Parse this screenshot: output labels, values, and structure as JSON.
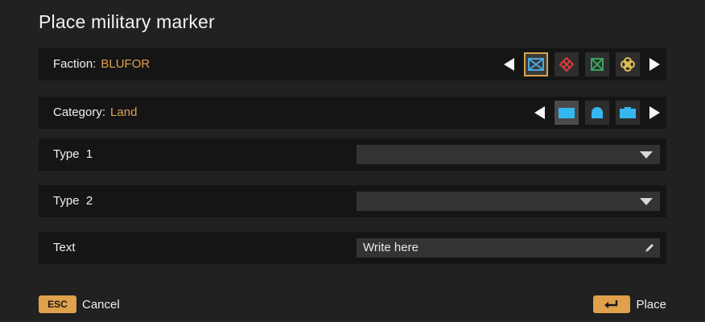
{
  "dialog": {
    "title": "Place military marker"
  },
  "faction": {
    "label": "Faction:",
    "value": "BLUFOR",
    "options": [
      {
        "name": "blufor-icon",
        "color": "#4aa8e0",
        "selected": true
      },
      {
        "name": "opfor-icon",
        "color": "#e03a3a",
        "selected": false
      },
      {
        "name": "independent-icon",
        "color": "#3aa35a",
        "selected": false
      },
      {
        "name": "civilian-icon",
        "color": "#e0c050",
        "selected": false
      }
    ]
  },
  "category": {
    "label": "Category:",
    "value": "Land",
    "options": [
      {
        "name": "land-icon",
        "color": "#35b8ef",
        "selected": true
      },
      {
        "name": "air-icon",
        "color": "#35b8ef",
        "selected": false
      },
      {
        "name": "sea-icon",
        "color": "#35b8ef",
        "selected": false
      }
    ]
  },
  "type1": {
    "label": "Type  1",
    "value": ""
  },
  "type2": {
    "label": "Type  2",
    "value": ""
  },
  "text_field": {
    "label": "Text",
    "placeholder": "Write here"
  },
  "footer": {
    "cancel_key": "ESC",
    "cancel_label": "Cancel",
    "place_label": "Place"
  },
  "colors": {
    "accent": "#e0a04c",
    "faction_value": "#e0a050"
  }
}
